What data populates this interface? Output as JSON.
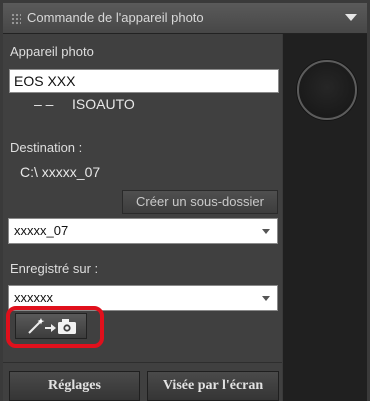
{
  "panel": {
    "title": "Commande de l'appareil photo",
    "icons": {
      "grip": "grip-icon",
      "collapse": "collapse-triangle-icon",
      "import": "wand-camera-icon"
    }
  },
  "camera": {
    "section_label": "Appareil photo",
    "model": "EOS XXX",
    "status_dashes": "– –",
    "iso": "ISOAUTO"
  },
  "destination": {
    "label": "Destination :",
    "path": "C:\\ xxxxx_07",
    "create_subfolder_label": "Créer un sous-dossier",
    "folder_value": "xxxxx_07"
  },
  "recorded_on": {
    "label": "Enregistré sur :",
    "value": "xxxxxx"
  },
  "buttons": {
    "settings": "Réglages",
    "live_view": "Visée par l'écran"
  },
  "colors": {
    "highlight": "#e0101c"
  }
}
